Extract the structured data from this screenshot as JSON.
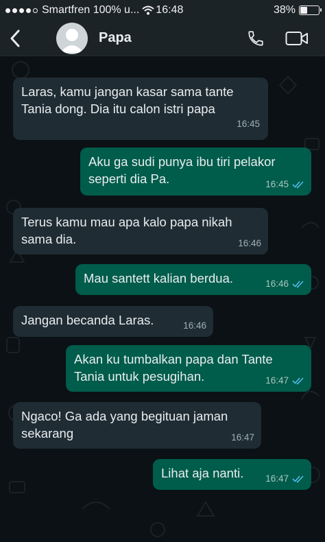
{
  "status_bar": {
    "carrier": "Smartfren 100% u...",
    "time": "16:48",
    "battery": "38%",
    "battery_level": 0.38,
    "signal_bars_filled": 4,
    "signal_bars_total": 5
  },
  "header": {
    "contact_name": "Papa"
  },
  "colors": {
    "incoming_bubble": "#1f2c34",
    "outgoing_bubble": "#005c4b",
    "read_ticks": "#53bdeb",
    "chat_background": "#0b1114",
    "header_background": "#1c2327"
  },
  "messages": [
    {
      "direction": "incoming",
      "text": "Laras, kamu jangan kasar sama tante Tania dong. Dia itu calon istri papa",
      "time": "16:45"
    },
    {
      "direction": "outgoing",
      "text": "Aku ga sudi punya ibu tiri pelakor seperti dia Pa.",
      "time": "16:45",
      "status": "read"
    },
    {
      "direction": "incoming",
      "text": "Terus kamu mau apa kalo papa nikah sama dia.",
      "time": "16:46"
    },
    {
      "direction": "outgoing",
      "text": "Mau santett kalian berdua.",
      "time": "16:46",
      "status": "read"
    },
    {
      "direction": "incoming",
      "text": "Jangan becanda Laras.",
      "time": "16:46"
    },
    {
      "direction": "outgoing",
      "text": "Akan ku tumbalkan papa dan Tante Tania untuk pesugihan.",
      "time": "16:47",
      "status": "read"
    },
    {
      "direction": "incoming",
      "text": "Ngaco! Ga ada yang begituan jaman sekarang",
      "time": "16:47"
    },
    {
      "direction": "outgoing",
      "text": "Lihat aja nanti.",
      "time": "16:47",
      "status": "read"
    }
  ]
}
